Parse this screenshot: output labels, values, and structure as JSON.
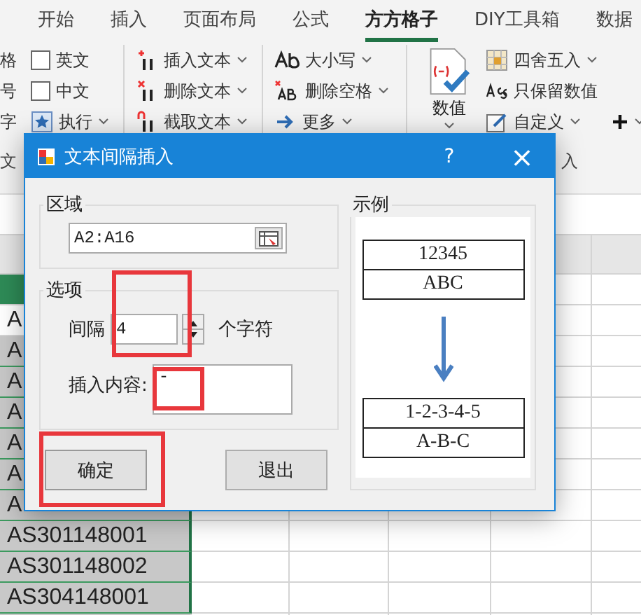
{
  "ribbon": {
    "tabs": [
      {
        "label": "开始",
        "selected": false
      },
      {
        "label": "插入",
        "selected": false
      },
      {
        "label": "页面布局",
        "selected": false
      },
      {
        "label": "公式",
        "selected": false
      },
      {
        "label": "方方格子",
        "selected": true
      },
      {
        "label": "DIY工具箱",
        "selected": false
      },
      {
        "label": "数据",
        "selected": false
      }
    ],
    "groups": [
      {
        "label": "文",
        "columns": [
          [
            {
              "kind": "plain",
              "label": "格"
            },
            {
              "kind": "plain",
              "label": "号"
            },
            {
              "kind": "plain",
              "label": "字"
            }
          ],
          [
            {
              "kind": "checkbox",
              "label": "英文",
              "checked": false
            },
            {
              "kind": "checkbox",
              "label": "中文",
              "checked": false
            },
            {
              "kind": "command",
              "label": "执行",
              "dropdown": true
            }
          ]
        ]
      },
      {
        "columns": [
          [
            {
              "kind": "command",
              "label": "插入文本",
              "dropdown": true
            },
            {
              "kind": "command",
              "label": "删除文本",
              "dropdown": true
            },
            {
              "kind": "command",
              "label": "截取文本",
              "dropdown": true
            }
          ]
        ]
      },
      {
        "columns": [
          [
            {
              "kind": "command",
              "label": "大小写",
              "dropdown": true
            },
            {
              "kind": "command",
              "label": "删除空格",
              "dropdown": true
            },
            {
              "kind": "command",
              "label": "更多",
              "dropdown": true
            }
          ]
        ]
      },
      {
        "label": "入",
        "columns": [
          [
            {
              "kind": "large",
              "label": "数值",
              "dropdown": true
            }
          ],
          [
            {
              "kind": "command",
              "label": "四舍五入",
              "dropdown": true
            },
            {
              "kind": "command",
              "label": "只保留数值",
              "dropdown": false
            },
            {
              "kind": "command",
              "label": "自定义",
              "dropdown": true
            }
          ],
          [
            {
              "kind": "spacer"
            },
            {
              "kind": "spacer"
            },
            {
              "kind": "command",
              "dropdown": true
            }
          ]
        ]
      }
    ]
  },
  "sheet": {
    "column_a": [
      {
        "text": "A",
        "selected": false
      },
      {
        "text": "A",
        "selected": true
      },
      {
        "text": "A",
        "selected": true
      },
      {
        "text": "A",
        "selected": true
      },
      {
        "text": "A",
        "selected": true
      },
      {
        "text": "A",
        "selected": true
      },
      {
        "text": "A",
        "selected": true
      },
      {
        "text": "AS301148001",
        "selected": true
      },
      {
        "text": "AS301148002",
        "selected": true
      },
      {
        "text": "AS304148001",
        "selected": true
      }
    ]
  },
  "dialog": {
    "title": "文本间隔插入",
    "help": "?",
    "close": "×",
    "range": {
      "legend": "区域",
      "value": "A2:A16"
    },
    "options": {
      "legend": "选项",
      "interval_label": "间隔",
      "interval_value": "4",
      "interval_unit": "个字符",
      "content_label": "插入内容:",
      "content_value": "-"
    },
    "buttons": [
      {
        "label": "确定",
        "kind": "default"
      },
      {
        "label": "退出",
        "kind": "normal"
      }
    ],
    "example": {
      "legend": "示例",
      "before": [
        "12345",
        "ABC"
      ],
      "after": [
        "1-2-3-4-5",
        "A-B-C"
      ]
    }
  }
}
